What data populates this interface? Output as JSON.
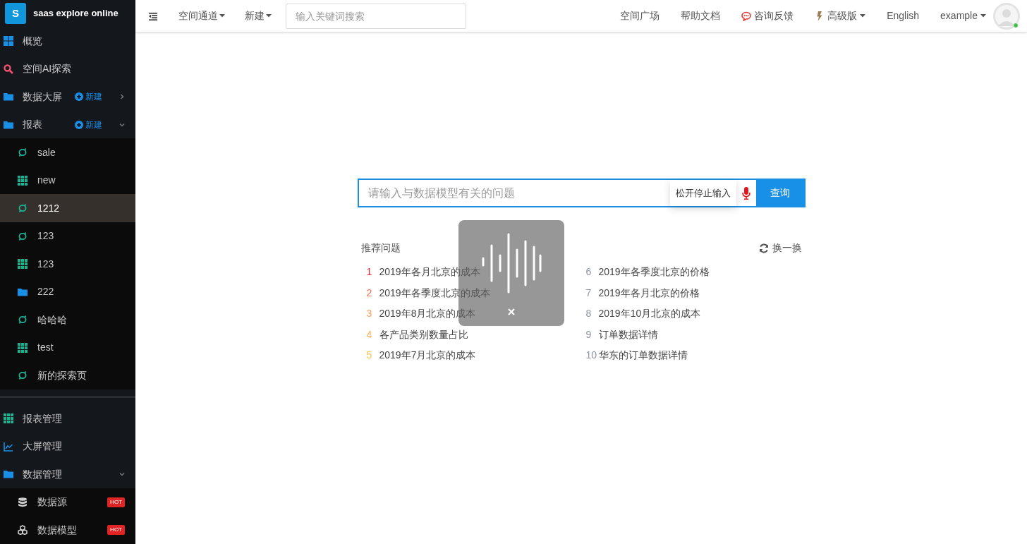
{
  "logo": {
    "letter": "S",
    "title": "saas explore online"
  },
  "sidebar": {
    "items": [
      {
        "label": "概览",
        "kind": "tiles",
        "selected": false
      },
      {
        "label": "空间AI探索",
        "kind": "search",
        "selected": false
      },
      {
        "label": "数据大屏",
        "kind": "folder",
        "selected": false,
        "action": "新建",
        "expanded": false
      },
      {
        "label": "报表",
        "kind": "folder",
        "selected": false,
        "action": "新建",
        "expanded": true,
        "children": [
          {
            "label": "sale",
            "kind": "ring",
            "selected": false
          },
          {
            "label": "new",
            "kind": "grid",
            "selected": false
          },
          {
            "label": "1212",
            "kind": "ring",
            "selected": true
          },
          {
            "label": "123",
            "kind": "ring",
            "selected": false
          },
          {
            "label": "123",
            "kind": "grid",
            "selected": false
          },
          {
            "label": "222",
            "kind": "folder",
            "selected": false
          },
          {
            "label": "哈哈哈",
            "kind": "ring",
            "selected": false
          },
          {
            "label": "test",
            "kind": "grid",
            "selected": false
          },
          {
            "label": "新的探索页",
            "kind": "ring",
            "selected": false
          }
        ]
      }
    ],
    "manage": [
      {
        "label": "报表管理",
        "kind": "grid",
        "selected": false
      },
      {
        "label": "大屏管理",
        "kind": "chart",
        "selected": false
      },
      {
        "label": "数据管理",
        "kind": "folder",
        "selected": false,
        "expanded": true,
        "children": [
          {
            "label": "数据源",
            "kind": "db",
            "selected": false,
            "badge": "HOT"
          },
          {
            "label": "数据模型",
            "kind": "cubes",
            "selected": false,
            "badge": "HOT"
          }
        ]
      }
    ]
  },
  "topbar": {
    "nav": [
      {
        "label": "空间通道",
        "dropdown": true
      },
      {
        "label": "新建",
        "dropdown": true
      }
    ],
    "search": {
      "placeholder": "输入关键词搜索"
    },
    "links": [
      {
        "label": "空间广场"
      },
      {
        "label": "帮助文档"
      },
      {
        "label": "咨询反馈",
        "kind": "chat"
      },
      {
        "label": "高级版",
        "kind": "bolt",
        "dropdown": true
      },
      {
        "label": "English"
      },
      {
        "label": "example",
        "dropdown": true
      }
    ],
    "avatar": {
      "online": true
    }
  },
  "query": {
    "placeholder": "请输入与数据模型有关的问题",
    "tooltip": "松开停止输入",
    "button": "查询"
  },
  "recommend": {
    "title": "推荐问题",
    "refresh": "换一换",
    "questions": [
      {
        "rank": "1",
        "text": "2019年各月北京的成本",
        "color": "#f5222d"
      },
      {
        "rank": "2",
        "text": "2019年各季度北京的成本",
        "color": "#ff6a4d"
      },
      {
        "rank": "3",
        "text": "2019年8月北京的成本",
        "color": "#ff9f5a"
      },
      {
        "rank": "4",
        "text": "各产品类别数量占比",
        "color": "#ffb14d"
      },
      {
        "rank": "5",
        "text": "2019年7月北京的成本",
        "color": "#ffc04d"
      },
      {
        "rank": "6",
        "text": "2019年各季度北京的价格",
        "color": "#8c93a8"
      },
      {
        "rank": "7",
        "text": "2019年各月北京的价格",
        "color": "#8c93a8"
      },
      {
        "rank": "8",
        "text": "2019年10月北京的成本",
        "color": "#8c93a8"
      },
      {
        "rank": "9",
        "text": "订单数据详情",
        "color": "#8c93a8"
      },
      {
        "rank": "10",
        "text": "华东的订单数据详情",
        "color": "#8c93a8"
      }
    ]
  },
  "voice": {
    "recording": true
  }
}
